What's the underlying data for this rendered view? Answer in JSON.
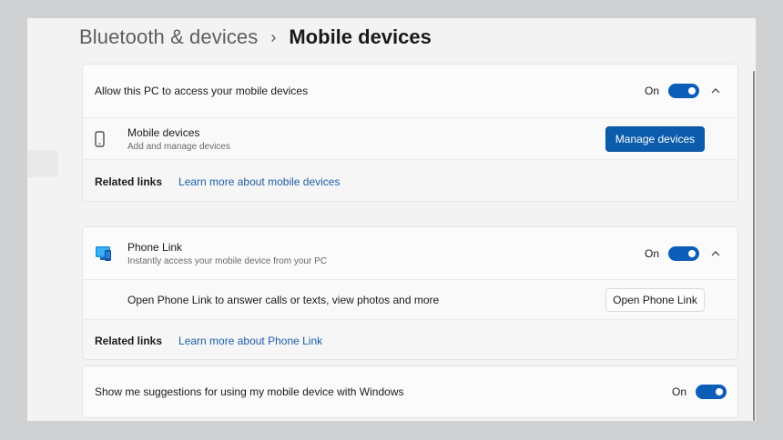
{
  "breadcrumb": {
    "parent": "Bluetooth & devices",
    "separator": "›",
    "current": "Mobile devices"
  },
  "mobile_access": {
    "title": "Allow this PC to access your mobile devices",
    "state_label": "On",
    "toggle_on": true,
    "expand_icon": "chevron-up-icon",
    "device_row": {
      "icon": "phone-icon",
      "title": "Mobile devices",
      "subtitle": "Add and manage devices",
      "button_label": "Manage devices"
    },
    "related_links": {
      "label": "Related links",
      "link": "Learn more about mobile devices"
    }
  },
  "phone_link": {
    "icon": "phone-link-app-icon",
    "title": "Phone Link",
    "subtitle": "Instantly access your mobile device from your PC",
    "state_label": "On",
    "toggle_on": true,
    "expand_icon": "chevron-up-icon",
    "open_row": {
      "text": "Open Phone Link to answer calls or texts, view photos and more",
      "button_label": "Open Phone Link"
    },
    "related_links": {
      "label": "Related links",
      "link": "Learn more about Phone Link"
    }
  },
  "suggestions": {
    "title": "Show me suggestions for using my mobile device with Windows",
    "state_label": "On",
    "toggle_on": true
  },
  "colors": {
    "accent": "#0c5db8",
    "link": "#1d5ea8",
    "background": "#f3f3f3",
    "card": "#fbfbfb"
  }
}
